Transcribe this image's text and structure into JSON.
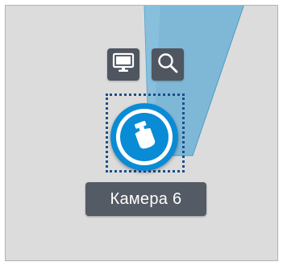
{
  "map_view": {
    "background_color": "#dcdcdc",
    "field_of_view_color": "#6fb2d6"
  },
  "camera": {
    "label": "Камера 6",
    "icon": "camera-dome-icon",
    "accent_color": "#0a8bd6",
    "selected": true
  },
  "toolbar": {
    "buttons": [
      {
        "icon": "monitor-icon"
      },
      {
        "icon": "search-icon"
      }
    ]
  }
}
